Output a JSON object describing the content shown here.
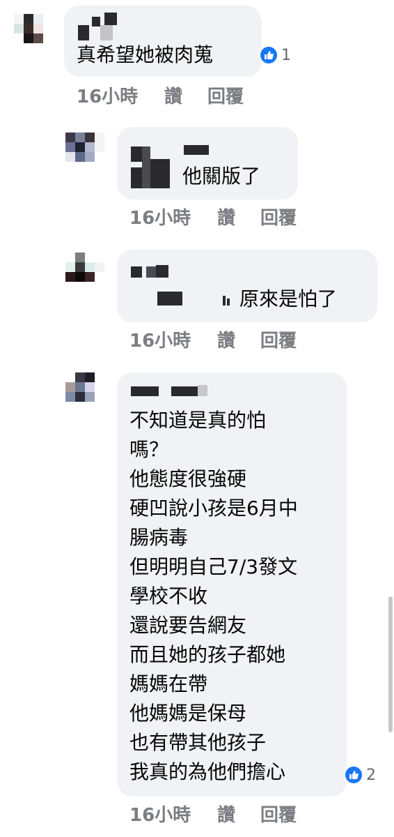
{
  "comments": [
    {
      "text": "真希望她被肉蒐",
      "time": "16小時",
      "like_label": "讚",
      "reply_label": "回覆",
      "reaction_count": "1"
    },
    {
      "text": "他關版了",
      "time": "16小時",
      "like_label": "讚",
      "reply_label": "回覆"
    },
    {
      "text": "原來是怕了",
      "time": "16小時",
      "like_label": "讚",
      "reply_label": "回覆"
    },
    {
      "lines": [
        "不知道是真的怕",
        "嗎？",
        "他態度很強硬",
        "硬凹說小孩是6月中",
        "腸病毒",
        "但明明自己7/3發文",
        "學校不收",
        "還說要告網友",
        "而且她的孩子都她",
        "媽媽在帶",
        "他媽媽是保母",
        "也有帶其他孩子",
        "我真的為他們擔心"
      ],
      "time": "16小時",
      "like_label": "讚",
      "reply_label": "回覆",
      "reaction_count": "2"
    }
  ],
  "colors": {
    "bubble": "#f0f2f5",
    "meta_text": "#7b7d82",
    "like_blue": "#1877f2"
  }
}
